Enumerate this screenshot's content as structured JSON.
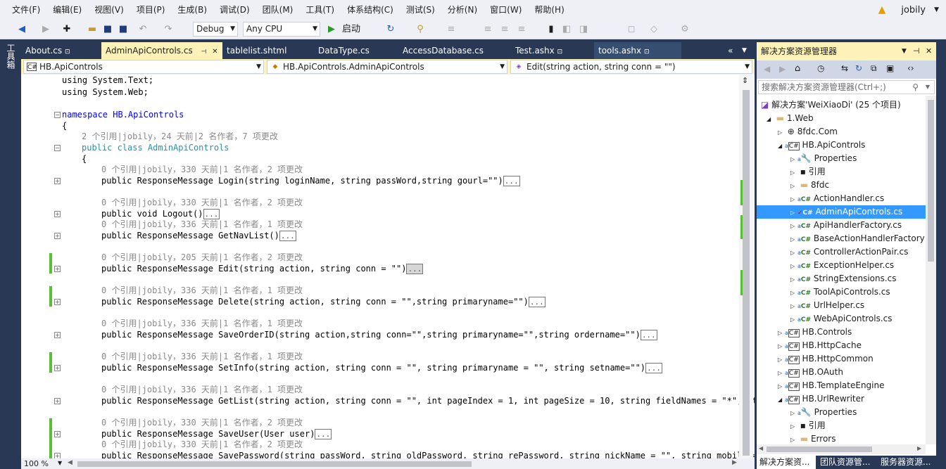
{
  "menu": [
    "文件(F)",
    "编辑(E)",
    "视图(V)",
    "项目(P)",
    "生成(B)",
    "调试(D)",
    "团队(M)",
    "工具(T)",
    "体系结构(C)",
    "测试(S)",
    "分析(N)",
    "窗口(W)",
    "帮助(H)"
  ],
  "user": "jobily",
  "toolbar": {
    "config": "Debug",
    "platform": "Any CPU",
    "start_label": "启动"
  },
  "left_tool": "工具箱",
  "tabs": [
    "About.cs",
    "AdminApiControls.cs",
    "tablelist.shtml",
    "DataType.cs",
    "AccessDatabase.cs",
    "Test.ashx",
    "tools.ashx"
  ],
  "nav": {
    "project": "HB.ApiControls",
    "class": "HB.ApiControls.AdminApiControls",
    "member": "Edit(string action, string conn = \"\")"
  },
  "zoom": "100 %",
  "code": {
    "l1": "using System.Text;",
    "l2": "using System.Web;",
    "ns": "namespace HB.ApiControls",
    "brace": "{",
    "lens_class": "2 个引用|jobily，24 天前|2 名作者，7 项更改",
    "class_decl": "public class AdminApiControls",
    "brace2": "{",
    "methods": [
      {
        "lens": "0 个引用|jobily，330 天前|1 名作者，2 项更改",
        "sig": "public ResponseMessage Login(string loginName, string passWord,string gourl=\"\")"
      },
      {
        "lens": "0 个引用|jobily，330 天前|1 名作者，2 项更改",
        "sig": "public void Logout()"
      },
      {
        "lens": "0 个引用|jobily，336 天前|1 名作者，1 项更改",
        "sig": "public ResponseMessage GetNavList()"
      },
      {
        "lens": "0 个引用|jobily，205 天前|1 名作者，2 项更改",
        "sig": "public ResponseMessage Edit(string action, string conn = \"\")"
      },
      {
        "lens": "0 个引用|jobily，336 天前|1 名作者，1 项更改",
        "sig": "public ResponseMessage Delete(string action, string conn = \"\",string primaryname=\"\")"
      },
      {
        "lens": "0 个引用|jobily，336 天前|1 名作者，1 项更改",
        "sig": "public ResponseMessage SaveOrderID(string action,string conn=\"\",string primaryname=\"\",string ordername=\"\")"
      },
      {
        "lens": "0 个引用|jobily，336 天前|1 名作者，1 项更改",
        "sig": "public ResponseMessage SetInfo(string action, string conn = \"\", string primaryname = \"\", string setname=\"\")"
      },
      {
        "lens": "0 个引用|jobily，336 天前|1 名作者，1 项更改",
        "sig": "public ResponseMessage GetList(string action, string conn = \"\", int pageIndex = 1, int pageSize = 10, string fieldNames = \"*\", str"
      },
      {
        "lens": "0 个引用|jobily，330 天前|1 名作者，2 项更改",
        "sig": "public ResponseMessage SaveUser(User user)"
      },
      {
        "lens": "0 个引用|jobily，330 天前|1 名作者，2 项更改",
        "sig": "public ResponseMessage SavePassword(string passWord, string oldPassword, string rePassword, string nickName = \"\", string mobile ="
      }
    ]
  },
  "solution_explorer": {
    "title": "解决方案资源管理器",
    "search_placeholder": "搜索解决方案资源管理器(Ctrl+;)",
    "items": [
      "解决方案'WeiXiaoDi' (25 个项目)",
      "1.Web",
      "8fdc.Com",
      "HB.ApiControls",
      "Properties",
      "引用",
      "8fdc",
      "ActionHandler.cs",
      "AdminApiControls.cs",
      "ApiHandlerFactory.cs",
      "BaseActionHandlerFactory",
      "ControllerActionPair.cs",
      "ExceptionHelper.cs",
      "StringExtensions.cs",
      "ToolApiControls.cs",
      "UrlHelper.cs",
      "WebApiControls.cs",
      "HB.Controls",
      "HB.HttpCache",
      "HB.HttpCommon",
      "HB.OAuth",
      "HB.TemplateEngine",
      "HB.UrlRewriter",
      "Properties",
      "引用",
      "Errors"
    ]
  },
  "bottom_tabs": [
    "解决方案资...",
    "团队资源管...",
    "服务器资源..."
  ]
}
